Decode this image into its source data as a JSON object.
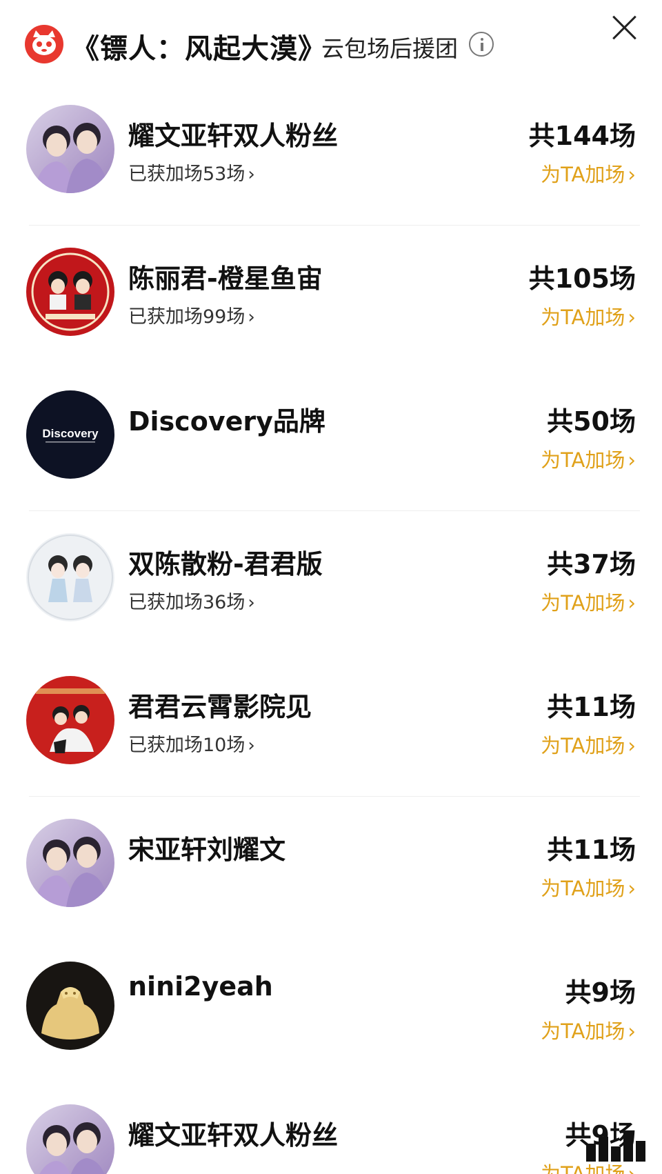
{
  "header": {
    "title": "《镖人：风起大漠》",
    "subtitle": "云包场后援团",
    "logo_icon": "cat-logo-icon",
    "info_icon": "info-icon",
    "close_icon": "close-icon"
  },
  "colors": {
    "accent": "#e0a11a",
    "logo": "#e8382f",
    "text": "#111111"
  },
  "items": [
    {
      "name": "耀文亚轩双人粉丝",
      "added": "已获加场53场",
      "total": "共144场",
      "action": "为TA加场"
    },
    {
      "name": "陈丽君-橙星鱼宙",
      "added": "已获加场99场",
      "total": "共105场",
      "action": "为TA加场"
    },
    {
      "name": "Discovery品牌",
      "added": "",
      "total": "共50场",
      "action": "为TA加场",
      "avatar_text": "Discovery"
    },
    {
      "name": "双陈散粉-君君版",
      "added": "已获加场36场",
      "total": "共37场",
      "action": "为TA加场"
    },
    {
      "name": "君君云霄影院见",
      "added": "已获加场10场",
      "total": "共11场",
      "action": "为TA加场"
    },
    {
      "name": "宋亚轩刘耀文",
      "added": "",
      "total": "共11场",
      "action": "为TA加场"
    },
    {
      "name": "nini2yeah",
      "added": "",
      "total": "共9场",
      "action": "为TA加场"
    },
    {
      "name": "耀文亚轩双人粉丝",
      "added": "",
      "total": "共9场",
      "action": "为TA加场"
    }
  ],
  "chevron": "›"
}
